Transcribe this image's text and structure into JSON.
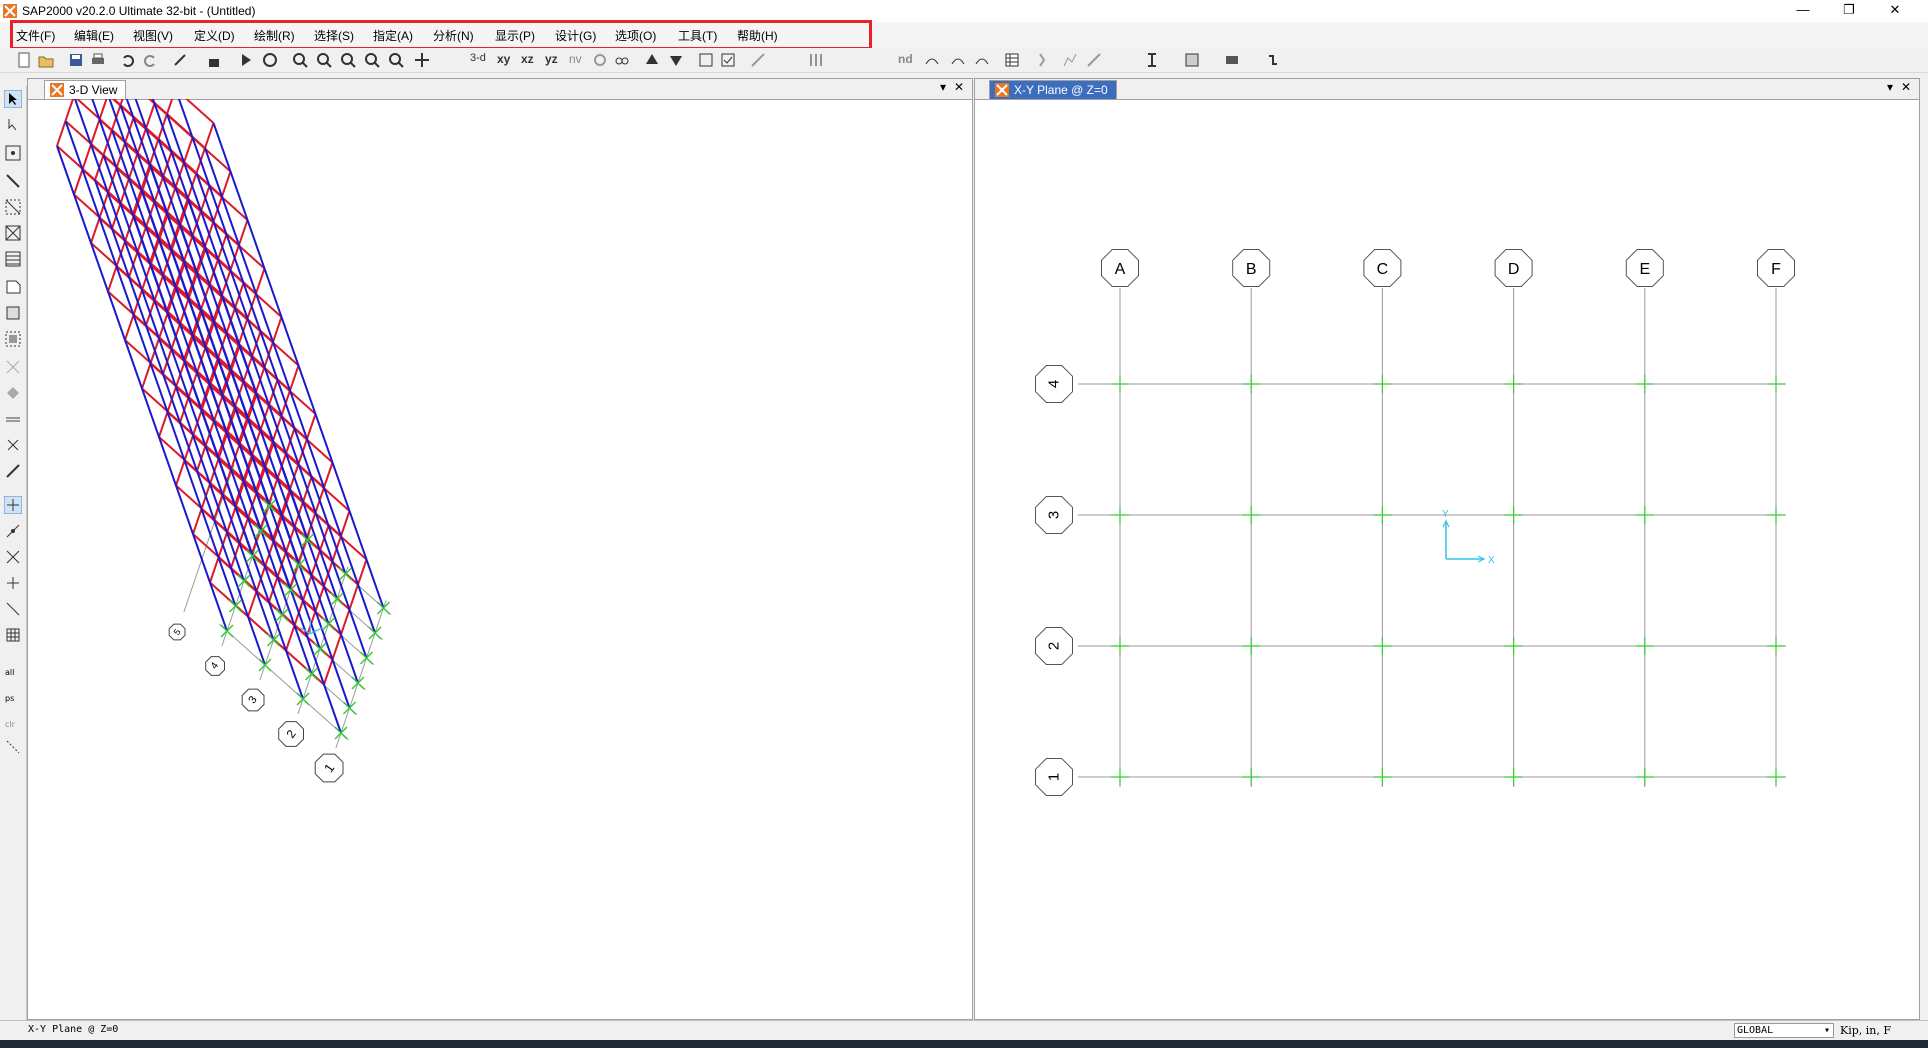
{
  "window": {
    "title": "SAP2000 v20.2.0 Ultimate 32-bit - (Untitled)",
    "controls": {
      "minimize": "—",
      "restore": "❐",
      "close": "✕"
    }
  },
  "menu": {
    "items": [
      {
        "label": "文件(F)"
      },
      {
        "label": "编辑(E)"
      },
      {
        "label": "视图(V)"
      },
      {
        "label": "定义(D)"
      },
      {
        "label": "绘制(R)"
      },
      {
        "label": "选择(S)"
      },
      {
        "label": "指定(A)"
      },
      {
        "label": "分析(N)"
      },
      {
        "label": "显示(P)"
      },
      {
        "label": "设计(G)"
      },
      {
        "label": "选项(O)"
      },
      {
        "label": "工具(T)"
      },
      {
        "label": "帮助(H)"
      }
    ]
  },
  "toolbar": {
    "view_3d": "3-d",
    "view_xy": "xy",
    "view_xz": "xz",
    "view_yz": "yz",
    "view_nv": "nv",
    "nd": "nd"
  },
  "panes": {
    "left": {
      "tab": "3-D View",
      "dropdown": "▾",
      "close": "✕"
    },
    "right": {
      "tab": "X-Y Plane @ Z=0",
      "dropdown": "▾",
      "close": "✕"
    }
  },
  "plan": {
    "column_labels": [
      "A",
      "B",
      "C",
      "D",
      "E",
      "F"
    ],
    "row_labels": [
      "4",
      "3",
      "2",
      "1"
    ],
    "axis_x": "X",
    "axis_y": "Y"
  },
  "view3d": {
    "bubbles": [
      "1",
      "2",
      "3",
      "4",
      "5"
    ]
  },
  "status": {
    "left_text": "X-Y Plane @ Z=0",
    "coord_system": "GLOBAL",
    "units": "Kip, in, F"
  },
  "colors": {
    "beams": "#dd1a2a",
    "columns": "#1a1acc",
    "supports": "#33cc33",
    "grid": "#999999",
    "highlight": "#e8222a"
  }
}
